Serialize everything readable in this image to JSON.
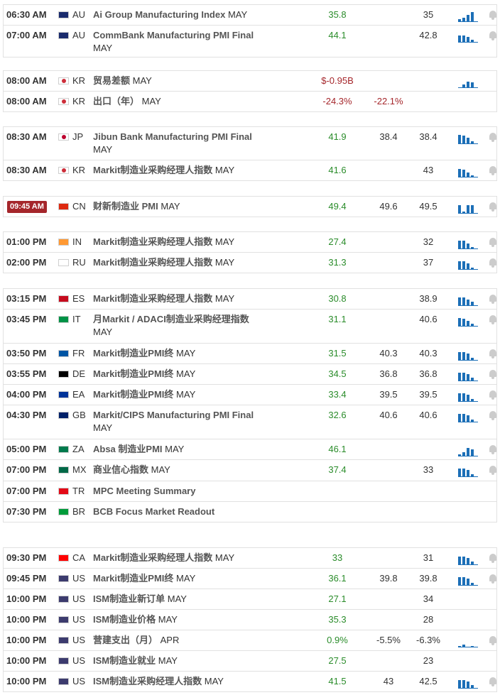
{
  "rows": [
    {
      "time": "06:30 AM",
      "cc": "AU",
      "ev": "Ai Group Manufacturing Index",
      "per": "MAY",
      "act": "35.8",
      "act_color": "green",
      "fc": "",
      "pr": "35",
      "bars": [
        4,
        6,
        10,
        14
      ],
      "bell": true
    },
    {
      "time": "07:00 AM",
      "cc": "AU",
      "ev": "CommBank Manufacturing PMI Final",
      "per": "MAY",
      "act": "44.1",
      "act_color": "green",
      "fc": "",
      "pr": "42.8",
      "bars": [
        10,
        10,
        8,
        4
      ],
      "bell": true
    },
    {
      "time": "08:00 AM",
      "cc": "KR",
      "ev": "贸易差额",
      "per": "MAY",
      "act": "$-0.95B",
      "act_color": "red",
      "fc": "",
      "pr": "",
      "bars": [
        0,
        5,
        9,
        8
      ],
      "bell": false
    },
    {
      "time": "08:00 AM",
      "cc": "KR",
      "ev": "出口（年）",
      "per": "MAY",
      "act": "-24.3%",
      "act_color": "red",
      "fc": "-22.1%",
      "fc_color": "red",
      "pr": "",
      "bars": [],
      "bell": false
    },
    {
      "time": "08:30 AM",
      "cc": "JP",
      "ev": "Jibun Bank Manufacturing PMI Final",
      "per": "MAY",
      "act": "41.9",
      "act_color": "green",
      "fc": "38.4",
      "pr": "38.4",
      "bars": [
        13,
        12,
        9,
        4
      ],
      "bell": true
    },
    {
      "time": "08:30 AM",
      "cc": "KR",
      "ev": "Markit制造业采购经理人指数",
      "per": "MAY",
      "act": "41.6",
      "act_color": "green",
      "fc": "",
      "pr": "43",
      "bars": [
        12,
        11,
        7,
        3
      ],
      "bell": true
    },
    {
      "time": "09:45 AM",
      "cc": "CN",
      "ev": "财新制造业 PMI",
      "per": "MAY",
      "act": "49.4",
      "act_color": "green",
      "fc": "49.6",
      "pr": "49.5",
      "bars": [
        12,
        3,
        12,
        12
      ],
      "bell": true,
      "now": true
    },
    {
      "time": "01:00 PM",
      "cc": "IN",
      "ev": "Markit制造业采购经理人指数",
      "per": "MAY",
      "act": "27.4",
      "act_color": "green",
      "fc": "",
      "pr": "32",
      "bars": [
        12,
        12,
        8,
        3
      ],
      "bell": true
    },
    {
      "time": "02:00 PM",
      "cc": "RU",
      "ev": "Markit制造业采购经理人指数",
      "per": "MAY",
      "act": "31.3",
      "act_color": "green",
      "fc": "",
      "pr": "37",
      "bars": [
        12,
        12,
        9,
        3
      ],
      "bell": true
    },
    {
      "time": "03:15 PM",
      "cc": "ES",
      "ev": "Markit制造业采购经理人指数",
      "per": "MAY",
      "act": "30.8",
      "act_color": "green",
      "fc": "",
      "pr": "38.9",
      "bars": [
        12,
        12,
        9,
        6
      ],
      "bell": true
    },
    {
      "time": "03:45 PM",
      "cc": "IT",
      "ev": "月Markit / ADACI制造业采购经理指数",
      "per": "MAY",
      "act": "31.1",
      "act_color": "green",
      "fc": "",
      "pr": "40.6",
      "bars": [
        12,
        11,
        8,
        4
      ],
      "bell": true
    },
    {
      "time": "03:50 PM",
      "cc": "FR",
      "ev": "Markit制造业PMI终",
      "per": "MAY",
      "act": "31.5",
      "act_color": "green",
      "fc": "40.3",
      "pr": "40.3",
      "bars": [
        12,
        12,
        10,
        4
      ],
      "bell": true
    },
    {
      "time": "03:55 PM",
      "cc": "DE",
      "ev": "Markit制造业PMI终",
      "per": "MAY",
      "act": "34.5",
      "act_color": "green",
      "fc": "36.8",
      "pr": "36.8",
      "bars": [
        12,
        12,
        10,
        5
      ],
      "bell": true
    },
    {
      "time": "04:00 PM",
      "cc": "EA",
      "ev": "Markit制造业PMI终",
      "per": "MAY",
      "act": "33.4",
      "act_color": "green",
      "fc": "39.5",
      "pr": "39.5",
      "bars": [
        12,
        12,
        10,
        4
      ],
      "bell": true
    },
    {
      "time": "04:30 PM",
      "cc": "GB",
      "ev": "Markit/CIPS Manufacturing PMI Final",
      "per": "MAY",
      "act": "32.6",
      "act_color": "green",
      "fc": "40.6",
      "pr": "40.6",
      "bars": [
        12,
        12,
        10,
        4
      ],
      "bell": true
    },
    {
      "time": "05:00 PM",
      "cc": "ZA",
      "ev": "Absa 制造业PMI",
      "per": "MAY",
      "act": "46.1",
      "act_color": "green",
      "fc": "",
      "pr": "",
      "bars": [
        3,
        6,
        12,
        10
      ],
      "bell": true
    },
    {
      "time": "07:00 PM",
      "cc": "MX",
      "ev": "商业信心指数",
      "per": "MAY",
      "act": "37.4",
      "act_color": "green",
      "fc": "",
      "pr": "33",
      "bars": [
        12,
        12,
        10,
        4
      ],
      "bell": true
    },
    {
      "time": "07:00 PM",
      "cc": "TR",
      "ev": "MPC Meeting Summary",
      "per": "",
      "act": "",
      "act_color": "green",
      "fc": "",
      "pr": "",
      "bars": [],
      "bell": false
    },
    {
      "time": "07:30 PM",
      "cc": "BR",
      "ev": "BCB Focus Market Readout",
      "per": "",
      "act": "",
      "act_color": "green",
      "fc": "",
      "pr": "",
      "bars": [],
      "bell": false
    },
    {
      "time": "09:30 PM",
      "cc": "CA",
      "ev": "Markit制造业采购经理人指数",
      "per": "MAY",
      "act": "33",
      "act_color": "green",
      "fc": "",
      "pr": "31",
      "bars": [
        12,
        12,
        10,
        5
      ],
      "bell": true
    },
    {
      "time": "09:45 PM",
      "cc": "US",
      "ev": "Markit制造业PMI终",
      "per": "MAY",
      "act": "36.1",
      "act_color": "green",
      "fc": "39.8",
      "pr": "39.8",
      "bars": [
        12,
        12,
        10,
        4
      ],
      "bell": true
    },
    {
      "time": "10:00 PM",
      "cc": "US",
      "ev": "ISM制造业新订单",
      "per": "MAY",
      "act": "27.1",
      "act_color": "green",
      "fc": "",
      "pr": "34",
      "bars": [],
      "bell": false
    },
    {
      "time": "10:00 PM",
      "cc": "US",
      "ev": "ISM制造业价格",
      "per": "MAY",
      "act": "35.3",
      "act_color": "green",
      "fc": "",
      "pr": "28",
      "bars": [],
      "bell": false
    },
    {
      "time": "10:00 PM",
      "cc": "US",
      "ev": "营建支出（月）",
      "per": "APR",
      "act": "0.9%",
      "act_color": "green",
      "fc": "-5.5%",
      "pr": "-6.3%",
      "bars": [
        2,
        4,
        0,
        2
      ],
      "bell": true
    },
    {
      "time": "10:00 PM",
      "cc": "US",
      "ev": "ISM制造业就业",
      "per": "MAY",
      "act": "27.5",
      "act_color": "green",
      "fc": "",
      "pr": "23",
      "bars": [],
      "bell": false
    },
    {
      "time": "10:00 PM",
      "cc": "US",
      "ev": "ISM制造业采购经理人指数",
      "per": "MAY",
      "act": "41.5",
      "act_color": "green",
      "fc": "43",
      "pr": "42.5",
      "bars": [
        12,
        12,
        10,
        5
      ],
      "bell": true
    }
  ],
  "flag_colors": {
    "AU": "#1a2b6d",
    "KR": "#ffffff",
    "JP": "#ffffff",
    "CN": "#de2910",
    "IN": "#ff9933",
    "RU": "#ffffff",
    "ES": "#c60b1e",
    "IT": "#009246",
    "FR": "#0055a4",
    "DE": "#000000",
    "EA": "#003399",
    "GB": "#012169",
    "ZA": "#007a4d",
    "MX": "#006847",
    "TR": "#e30a17",
    "BR": "#009b3a",
    "CA": "#ff0000",
    "US": "#3c3b6e"
  }
}
